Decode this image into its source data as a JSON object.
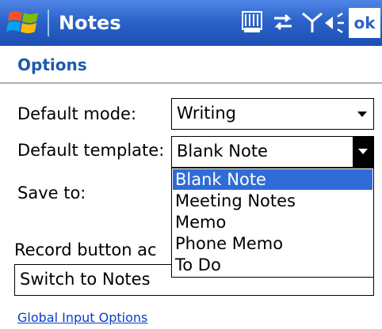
{
  "titlebar": {
    "app_title": "Notes",
    "ok_label": "ok",
    "status_icons": [
      "input-panel-icon",
      "connectivity-icon",
      "signal-icon",
      "volume-icon"
    ],
    "colors": {
      "bar_top": "#4f86e6",
      "bar_bottom": "#1b4eb2"
    }
  },
  "page": {
    "title": "Options",
    "title_color": "#1f5ba8"
  },
  "form": {
    "default_mode": {
      "label": "Default mode:",
      "value": "Writing"
    },
    "default_template": {
      "label": "Default template:",
      "value": "Blank Note",
      "options": [
        "Blank Note",
        "Meeting Notes",
        "Memo",
        "Phone Memo",
        "To Do"
      ],
      "highlighted": "Blank Note"
    },
    "save_to": {
      "label": "Save to:"
    },
    "record_button": {
      "label": "Record button ac",
      "value": "Switch to Notes"
    }
  },
  "link": {
    "label": "Global Input Options"
  },
  "colors": {
    "selection": "#2f6bd6",
    "link": "#0a3cc8"
  }
}
